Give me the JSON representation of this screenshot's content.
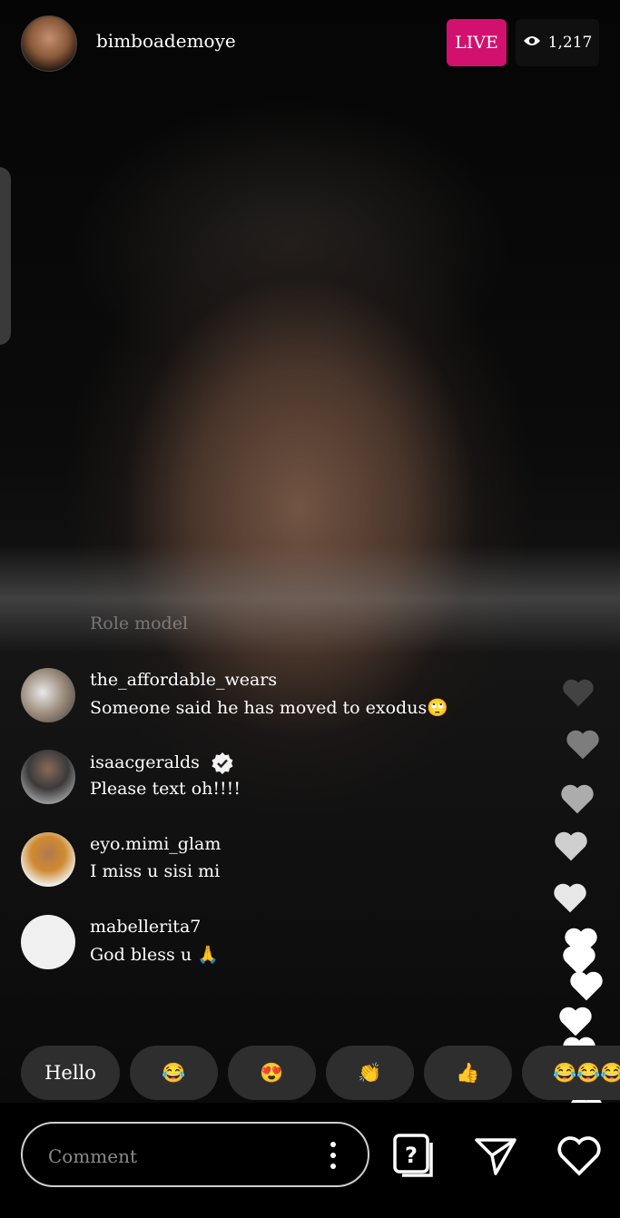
{
  "header": {
    "username": "bimboademoye",
    "live_label": "LIVE",
    "viewer_count": "1,217"
  },
  "comments": {
    "faded_text": "Role model",
    "items": [
      {
        "user": "the_affordable_wears",
        "text": "Someone said he has moved to exodus🙄",
        "verified": false
      },
      {
        "user": "isaacgeralds",
        "text": "Please text oh!!!!",
        "verified": true
      },
      {
        "user": "eyo.mimi_glam",
        "text": "I miss u sisi mi",
        "verified": false
      },
      {
        "user": "mabellerita7",
        "text": "God bless u 🙏",
        "verified": false
      }
    ]
  },
  "quick_replies": [
    "Hello",
    "😂",
    "😍",
    "👏",
    "👍",
    "😂😂😂"
  ],
  "comment_box": {
    "placeholder": "Comment"
  },
  "icons": [
    "eye-icon",
    "more-vertical-icon",
    "question-icon",
    "send-icon",
    "heart-icon",
    "verified-icon"
  ],
  "colors": {
    "live_badge": "#d1116d",
    "chip_bg": "#2e2e2e"
  }
}
